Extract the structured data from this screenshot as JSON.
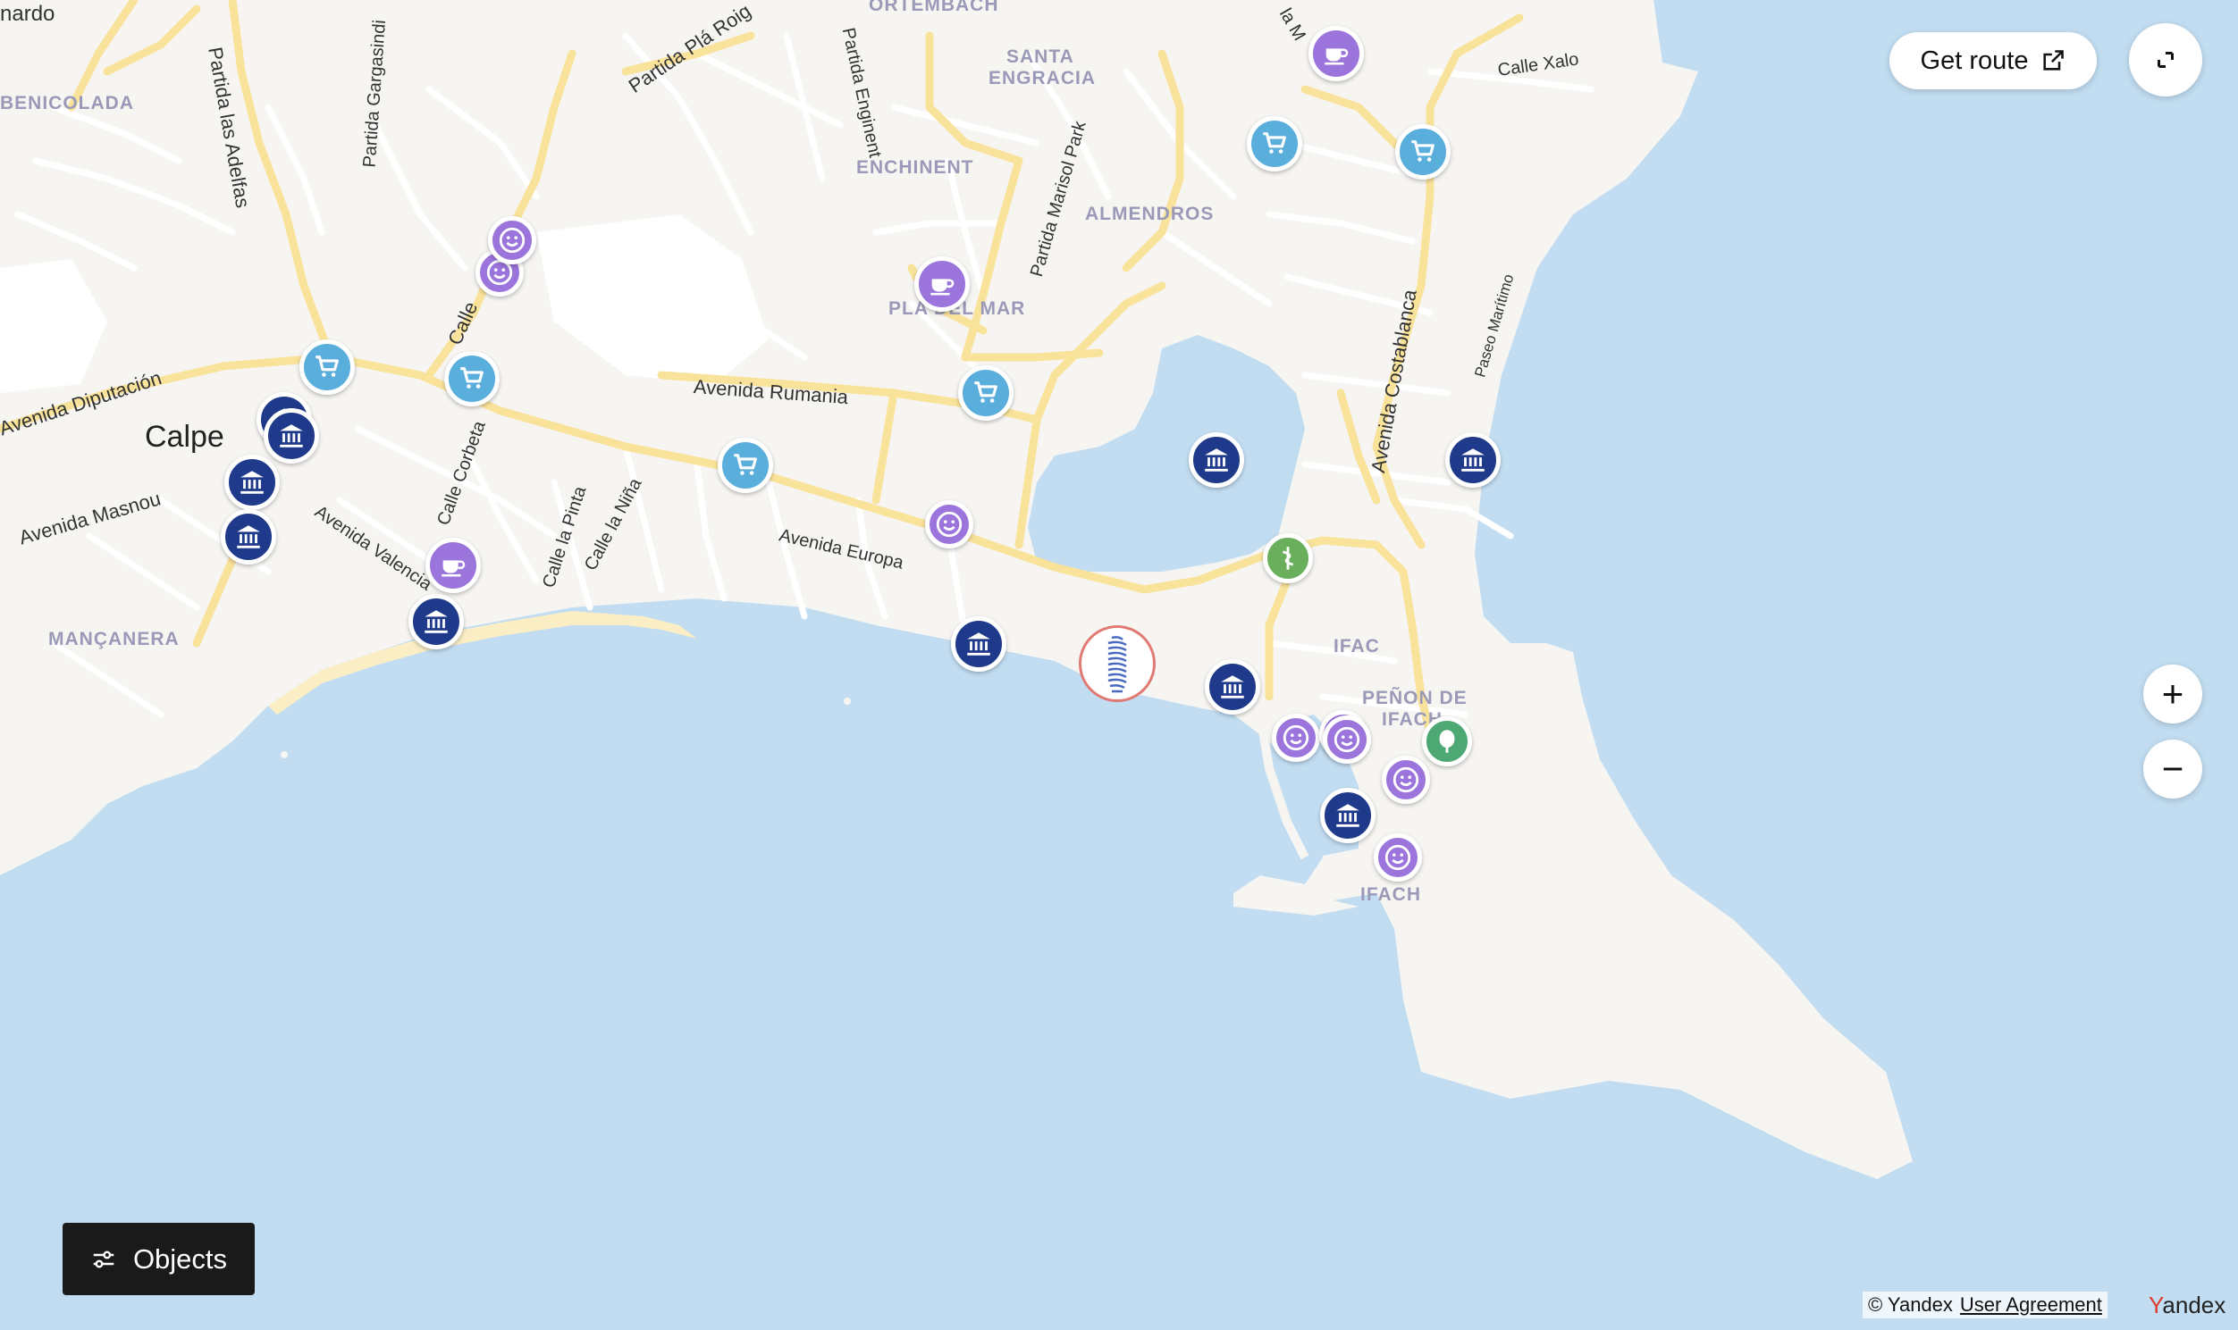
{
  "map": {
    "city": "Calpe",
    "districts": {
      "benicolada": "BENICOLADA",
      "ortembach": "ORTEMBACH",
      "santa_engracia_1": "SANTA",
      "santa_engracia_2": "ENGRACIA",
      "enchinent": "ENCHINENT",
      "almendros": "ALMENDROS",
      "pla_del_mar": "PLA DEL MAR",
      "mancanera": "MANÇANERA",
      "ifac": "IFAC",
      "penon_1": "PEÑON DE",
      "penon_2": "IFACH",
      "ifach": "IFACH"
    },
    "streets": {
      "nardo": "nardo",
      "adelfas": "Partida las Adelfas",
      "gargasindi": "Partida Gargasindi",
      "pla_roig": "Partida Plá Roig",
      "enginent": "Partida Enginent",
      "marisol": "Partida Marisol Park",
      "calle_xalo": "Calle Xalo",
      "calle": "Calle",
      "diputacion": "Avenida Diputación",
      "masnou": "Avenida Masnou",
      "valencia": "Avenida Valencia",
      "corbeta": "Calle Corbeta",
      "pinta": "Calle la Pinta",
      "nina": "Calle la Niña",
      "rumania": "Avenida Rumania",
      "europa": "Avenida Europa",
      "costablanca": "Avenida Costablanca",
      "paseo": "Paseo Marítimo",
      "la_m": "la M"
    }
  },
  "controls": {
    "route_label": "Get route",
    "objects_label": "Objects",
    "zoom_in": "+",
    "zoom_out": "−"
  },
  "footer": {
    "copyright": "© Yandex",
    "agreement": "User Agreement",
    "logo_y": "Y",
    "logo_rest": "andex"
  },
  "icons": {
    "museum": "museum-icon",
    "shop": "shopping-cart-icon",
    "cafe": "coffee-cup-icon",
    "fun": "smiley-icon",
    "pharmacy": "pharmacy-icon",
    "park": "tree-icon",
    "target": "tower-icon",
    "route": "external-link-icon",
    "expand": "expand-icon",
    "objects": "filter-sliders-icon"
  },
  "colors": {
    "water": "#c2ddf2",
    "land": "#f7f5f2",
    "road_major": "#f9e29a",
    "museum": "#1f3a8a",
    "shop": "#5aaedc",
    "cafe": "#9b74dc",
    "pharmacy": "#6aaf5c"
  }
}
